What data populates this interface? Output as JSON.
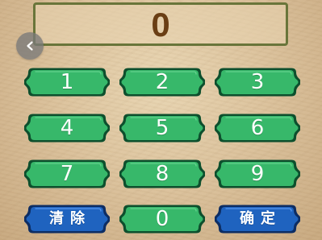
{
  "display": {
    "value": "0"
  },
  "controls": {
    "back_icon": "chevron-left-icon"
  },
  "keypad": {
    "rows": [
      [
        {
          "label": "1",
          "style": "green"
        },
        {
          "label": "2",
          "style": "green"
        },
        {
          "label": "3",
          "style": "green"
        }
      ],
      [
        {
          "label": "4",
          "style": "green"
        },
        {
          "label": "5",
          "style": "green"
        },
        {
          "label": "6",
          "style": "green"
        }
      ],
      [
        {
          "label": "7",
          "style": "green"
        },
        {
          "label": "8",
          "style": "green"
        },
        {
          "label": "9",
          "style": "green"
        }
      ],
      [
        {
          "label": "清除",
          "style": "blue"
        },
        {
          "label": "0",
          "style": "green"
        },
        {
          "label": "确定",
          "style": "blue"
        }
      ]
    ]
  },
  "colors": {
    "background": "#dcc39d",
    "display_border": "#69753a",
    "display_text": "#6a3e14",
    "green_key_fill": "#37b86a",
    "green_key_dark": "#0d4f2d",
    "blue_key_fill": "#1f63bf",
    "blue_key_dark": "#0d2d63"
  }
}
